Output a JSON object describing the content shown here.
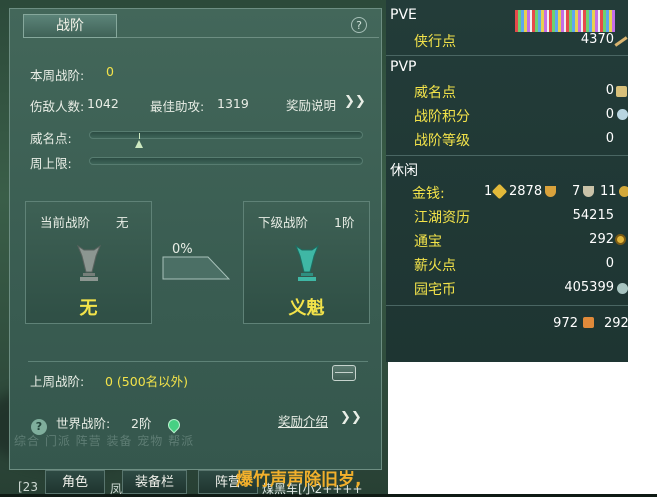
{
  "panel": {
    "title": "战阶",
    "help": "?",
    "weekly_rank_label": "本周战阶:",
    "weekly_rank_value": "0",
    "kills_label": "伤敌人数:",
    "kills_value": "1042",
    "best_assist_label": "最佳助攻:",
    "best_assist_value": "1319",
    "reward_desc_label": "奖励说明",
    "fame_label": "威名点:",
    "fame_progress": 0.15,
    "week_cap_label": "周上限:",
    "week_cap_progress": 0.0,
    "current_rank_label": "当前战阶",
    "current_rank_value": "无",
    "current_rank_name": "无",
    "next_rank_label": "下级战阶",
    "next_rank_value": "1阶",
    "next_rank_name": "义魁",
    "progress_percent": "0%",
    "last_week_label": "上周战阶:",
    "last_week_value": "0 (500名以外)",
    "world_rank_label": "世界战阶:",
    "world_rank_value": "2阶",
    "reward_intro_label": "奖励介绍"
  },
  "currency": {
    "pve_header": "PVE",
    "pve_items": [
      {
        "name": "侠行点",
        "value": "4370"
      }
    ],
    "pvp_header": "PVP",
    "pvp_items": [
      {
        "name": "威名点",
        "value": "0"
      },
      {
        "name": "战阶积分",
        "value": "0"
      },
      {
        "name": "战阶等级",
        "value": "0"
      }
    ],
    "leisure_header": "休闲",
    "money_label": "金钱:",
    "money_gold": "1",
    "money_silver": "2878",
    "money_copper": "7",
    "money_extra": "11",
    "leisure_items": [
      {
        "name": "江湖资历",
        "value": "54215"
      },
      {
        "name": "通宝",
        "value": "292"
      },
      {
        "name": "薪火点",
        "value": "0"
      },
      {
        "name": "园宅币",
        "value": "405399"
      }
    ],
    "footer_left_value": "972",
    "footer_right_value": "292"
  },
  "bottom_bar": {
    "tabs": [
      "角色",
      "装备栏",
      "阵营"
    ],
    "ghost_tabs": "综合  门派  阵营  装备  宠物  帮派",
    "chat_left": "[23",
    "chat_mid": "凤",
    "chat_right": "煤黑车[小2++++",
    "banner": "爆竹声声除旧岁,"
  },
  "colors": {
    "accent_yellow": "#f3e34a",
    "panel_bg": "#3f6257",
    "banner_orange": "#f2b02c"
  }
}
